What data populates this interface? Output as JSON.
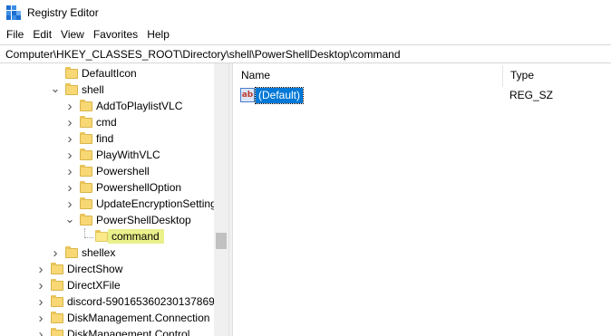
{
  "window": {
    "title": "Registry Editor"
  },
  "menu": [
    "File",
    "Edit",
    "View",
    "Favorites",
    "Help"
  ],
  "address": "Computer\\HKEY_CLASSES_ROOT\\Directory\\shell\\PowerShellDesktop\\command",
  "tree": {
    "items": [
      {
        "label": "DefaultIcon",
        "chevron": ""
      },
      {
        "label": "shell",
        "chevron": "down"
      },
      {
        "label": "AddToPlaylistVLC",
        "chevron": "right"
      },
      {
        "label": "cmd",
        "chevron": "right"
      },
      {
        "label": "find",
        "chevron": "right"
      },
      {
        "label": "PlayWithVLC",
        "chevron": "right"
      },
      {
        "label": "Powershell",
        "chevron": "right"
      },
      {
        "label": "PowershellOption",
        "chevron": "right"
      },
      {
        "label": "UpdateEncryptionSettingsWork",
        "chevron": "right"
      },
      {
        "label": "PowerShellDesktop",
        "chevron": "down"
      },
      {
        "label": "command",
        "chevron": "",
        "selected": true
      },
      {
        "label": "shellex",
        "chevron": "right"
      },
      {
        "label": "DirectShow",
        "chevron": "right"
      },
      {
        "label": "DirectXFile",
        "chevron": "right"
      },
      {
        "label": "discord-590165360230137869",
        "chevron": "right"
      },
      {
        "label": "DiskManagement.Connection",
        "chevron": "right"
      },
      {
        "label": "DiskManagement.Control",
        "chevron": "right"
      }
    ]
  },
  "values": {
    "columns": {
      "name": "Name",
      "type": "Type"
    },
    "rows": [
      {
        "name": "(Default)",
        "type": "REG_SZ",
        "icon": "ab-string-icon"
      }
    ]
  },
  "colors": {
    "selection": "#0078d7",
    "tree_highlight": "#eaf08a",
    "folder": "#f7d874"
  }
}
